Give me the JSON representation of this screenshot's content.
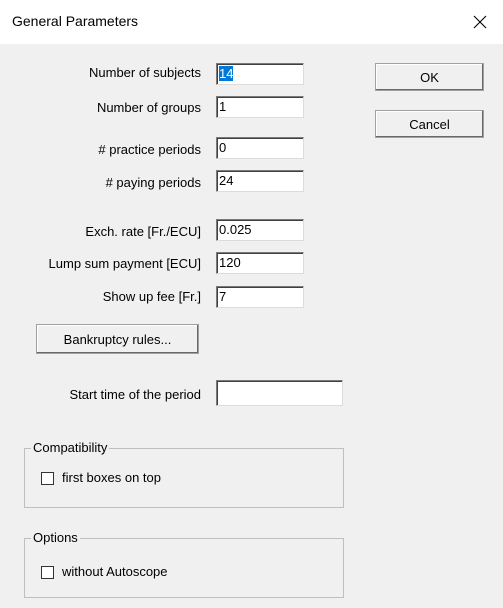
{
  "window": {
    "title": "General Parameters"
  },
  "fields": [
    {
      "label": "Number of subjects",
      "value": "14",
      "selected": true
    },
    {
      "label": "Number of groups",
      "value": "1"
    },
    {
      "label": "# practice periods",
      "value": "0"
    },
    {
      "label": "# paying periods",
      "value": "24"
    },
    {
      "label": "Exch. rate [Fr./ECU]",
      "value": "0.025"
    },
    {
      "label": "Lump sum payment [ECU]",
      "value": "120"
    },
    {
      "label": "Show up fee [Fr.]",
      "value": "7"
    }
  ],
  "buttons": {
    "ok": "OK",
    "cancel": "Cancel",
    "bankruptcy": "Bankruptcy rules..."
  },
  "start_time": {
    "label": "Start time of the period",
    "value": ""
  },
  "compatibility": {
    "title": "Compatibility",
    "checkbox_label": "first boxes on top",
    "checked": false
  },
  "options": {
    "title": "Options",
    "checkbox_label": "without Autoscope",
    "checked": false
  },
  "icons": {
    "close": "close-icon"
  },
  "colors": {
    "background": "#f0f0f0",
    "selection": "#0078d7"
  }
}
